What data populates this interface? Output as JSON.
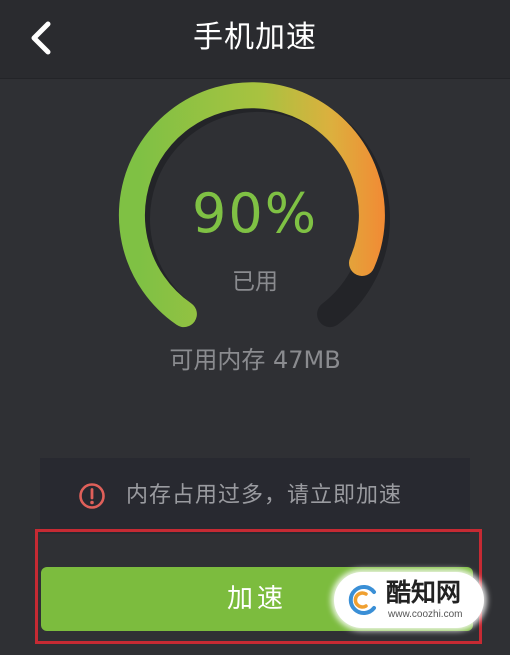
{
  "header": {
    "title": "手机加速",
    "back_icon": "chevron-left-icon"
  },
  "gauge": {
    "percent_text": "90%",
    "used_fraction": 0.9,
    "used_label": "已用",
    "colors": {
      "green": "#7fc144",
      "yellow": "#d9b23f",
      "orange": "#f28a34",
      "track": "#232428"
    }
  },
  "memory": {
    "available_text": "可用内存 47MB"
  },
  "warning": {
    "icon": "alert-circle-icon",
    "text": "内存占用过多，请立即加速"
  },
  "action": {
    "accelerate_label": "加速",
    "button_color": "#7cbc3e"
  },
  "highlight": {
    "color": "#c62a33"
  },
  "watermark": {
    "name": "酷知网",
    "url": "www.coozhi.com"
  }
}
